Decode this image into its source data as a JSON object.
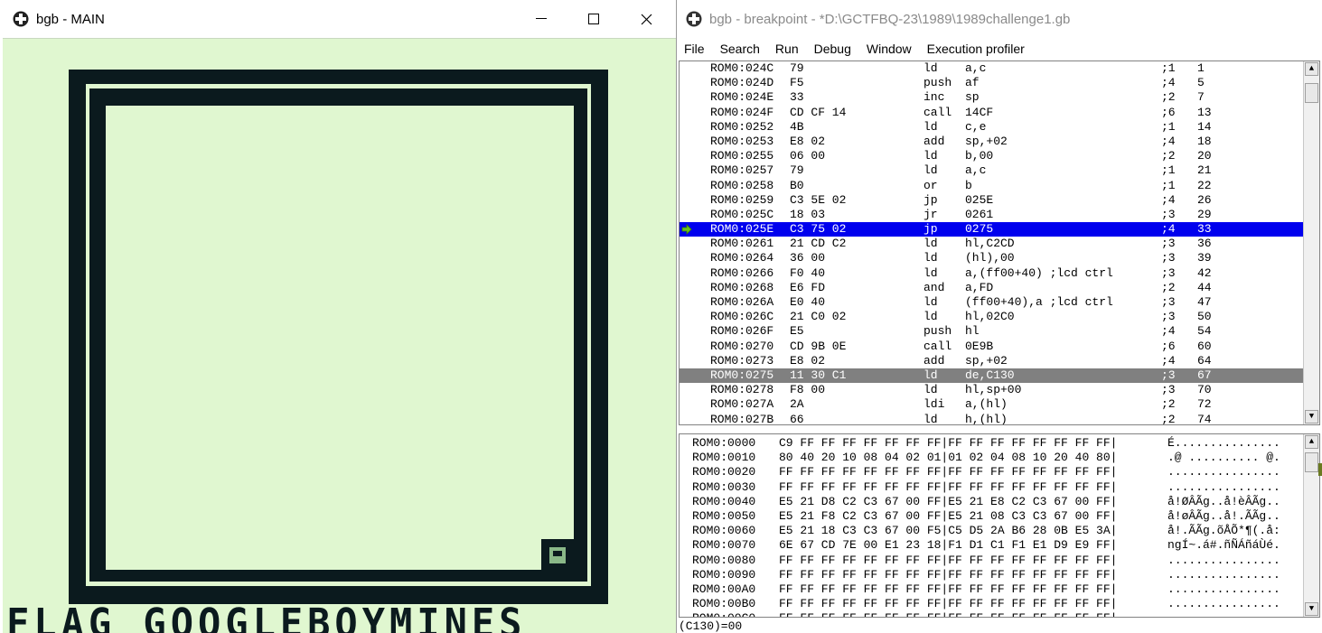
{
  "main_window": {
    "title": "bgb - MAIN",
    "controls": {
      "minimize": "—",
      "maximize": "☐",
      "close": "✕"
    },
    "game_text": "FLAG GOOGLEBOYMINES",
    "colors": {
      "screen_bg": "#e0f7d0",
      "dark": "#0b1a1e"
    }
  },
  "debugger_window": {
    "title": "bgb - breakpoint - *D:\\GCTFBQ-23\\1989\\1989challenge1.gb",
    "menu": [
      "File",
      "Search",
      "Run",
      "Debug",
      "Window",
      "Execution profiler"
    ],
    "disasm": [
      {
        "addr": "ROM0:024C",
        "bytes": "79",
        "mn": "ld",
        "op": "a,c",
        "cyc": ";1",
        "tot": "1"
      },
      {
        "addr": "ROM0:024D",
        "bytes": "F5",
        "mn": "push",
        "op": "af",
        "cyc": ";4",
        "tot": "5"
      },
      {
        "addr": "ROM0:024E",
        "bytes": "33",
        "mn": "inc",
        "op": "sp",
        "cyc": ";2",
        "tot": "7"
      },
      {
        "addr": "ROM0:024F",
        "bytes": "CD CF 14",
        "mn": "call",
        "op": "14CF",
        "cyc": ";6",
        "tot": "13"
      },
      {
        "addr": "ROM0:0252",
        "bytes": "4B",
        "mn": "ld",
        "op": "c,e",
        "cyc": ";1",
        "tot": "14"
      },
      {
        "addr": "ROM0:0253",
        "bytes": "E8 02",
        "mn": "add",
        "op": "sp,+02",
        "cyc": ";4",
        "tot": "18"
      },
      {
        "addr": "ROM0:0255",
        "bytes": "06 00",
        "mn": "ld",
        "op": "b,00",
        "cyc": ";2",
        "tot": "20"
      },
      {
        "addr": "ROM0:0257",
        "bytes": "79",
        "mn": "ld",
        "op": "a,c",
        "cyc": ";1",
        "tot": "21"
      },
      {
        "addr": "ROM0:0258",
        "bytes": "B0",
        "mn": "or",
        "op": "b",
        "cyc": ";1",
        "tot": "22"
      },
      {
        "addr": "ROM0:0259",
        "bytes": "C3 5E 02",
        "mn": "jp",
        "op": "025E",
        "cyc": ";4",
        "tot": "26"
      },
      {
        "addr": "ROM0:025C",
        "bytes": "18 03",
        "mn": "jr",
        "op": "0261",
        "cyc": ";3",
        "tot": "29"
      },
      {
        "addr": "ROM0:025E",
        "bytes": "C3 75 02",
        "mn": "jp",
        "op": "0275",
        "cyc": ";4",
        "tot": "33"
      },
      {
        "addr": "ROM0:0261",
        "bytes": "21 CD C2",
        "mn": "ld",
        "op": "hl,C2CD",
        "cyc": ";3",
        "tot": "36"
      },
      {
        "addr": "ROM0:0264",
        "bytes": "36 00",
        "mn": "ld",
        "op": "(hl),00",
        "cyc": ";3",
        "tot": "39"
      },
      {
        "addr": "ROM0:0266",
        "bytes": "F0 40",
        "mn": "ld",
        "op": "a,(ff00+40) ;lcd ctrl",
        "cyc": ";3",
        "tot": "42"
      },
      {
        "addr": "ROM0:0268",
        "bytes": "E6 FD",
        "mn": "and",
        "op": "a,FD",
        "cyc": ";2",
        "tot": "44"
      },
      {
        "addr": "ROM0:026A",
        "bytes": "E0 40",
        "mn": "ld",
        "op": "(ff00+40),a ;lcd ctrl",
        "cyc": ";3",
        "tot": "47"
      },
      {
        "addr": "ROM0:026C",
        "bytes": "21 C0 02",
        "mn": "ld",
        "op": "hl,02C0",
        "cyc": ";3",
        "tot": "50"
      },
      {
        "addr": "ROM0:026F",
        "bytes": "E5",
        "mn": "push",
        "op": "hl",
        "cyc": ";4",
        "tot": "54"
      },
      {
        "addr": "ROM0:0270",
        "bytes": "CD 9B 0E",
        "mn": "call",
        "op": "0E9B",
        "cyc": ";6",
        "tot": "60"
      },
      {
        "addr": "ROM0:0273",
        "bytes": "E8 02",
        "mn": "add",
        "op": "sp,+02",
        "cyc": ";4",
        "tot": "64"
      },
      {
        "addr": "ROM0:0275",
        "bytes": "11 30 C1",
        "mn": "ld",
        "op": "de,C130",
        "cyc": ";3",
        "tot": "67"
      },
      {
        "addr": "ROM0:0278",
        "bytes": "F8 00",
        "mn": "ld",
        "op": "hl,sp+00",
        "cyc": ";3",
        "tot": "70"
      },
      {
        "addr": "ROM0:027A",
        "bytes": "2A",
        "mn": "ldi",
        "op": "a,(hl)",
        "cyc": ";2",
        "tot": "72"
      },
      {
        "addr": "ROM0:027B",
        "bytes": "66",
        "mn": "ld",
        "op": "h,(hl)",
        "cyc": ";2",
        "tot": "74"
      }
    ],
    "current_row": 11,
    "cursor_row": 21,
    "hexdump": [
      {
        "addr": "ROM0:0000",
        "bytes": "C9 FF FF FF FF FF FF FF|FF FF FF FF FF FF FF FF|",
        "ascii": "É..............."
      },
      {
        "addr": "ROM0:0010",
        "bytes": "80 40 20 10 08 04 02 01|01 02 04 08 10 20 40 80|",
        "ascii": ".@ .......... @."
      },
      {
        "addr": "ROM0:0020",
        "bytes": "FF FF FF FF FF FF FF FF|FF FF FF FF FF FF FF FF|",
        "ascii": "................"
      },
      {
        "addr": "ROM0:0030",
        "bytes": "FF FF FF FF FF FF FF FF|FF FF FF FF FF FF FF FF|",
        "ascii": "................"
      },
      {
        "addr": "ROM0:0040",
        "bytes": "E5 21 D8 C2 C3 67 00 FF|E5 21 E8 C2 C3 67 00 FF|",
        "ascii": "å!ØÂÃg..å!èÂÃg.."
      },
      {
        "addr": "ROM0:0050",
        "bytes": "E5 21 F8 C2 C3 67 00 FF|E5 21 08 C3 C3 67 00 FF|",
        "ascii": "å!øÂÃg..å!.ÃÃg.."
      },
      {
        "addr": "ROM0:0060",
        "bytes": "E5 21 18 C3 C3 67 00 F5|C5 D5 2A B6 28 0B E5 3A|",
        "ascii": "å!.ÃÃg.õÅÕ*¶(.å:"
      },
      {
        "addr": "ROM0:0070",
        "bytes": "6E 67 CD 7E 00 E1 23 18|F1 D1 C1 F1 E1 D9 E9 FF|",
        "ascii": "ngÍ~.á#.ñÑÁñáÙé."
      },
      {
        "addr": "ROM0:0080",
        "bytes": "FF FF FF FF FF FF FF FF|FF FF FF FF FF FF FF FF|",
        "ascii": "................"
      },
      {
        "addr": "ROM0:0090",
        "bytes": "FF FF FF FF FF FF FF FF|FF FF FF FF FF FF FF FF|",
        "ascii": "................"
      },
      {
        "addr": "ROM0:00A0",
        "bytes": "FF FF FF FF FF FF FF FF|FF FF FF FF FF FF FF FF|",
        "ascii": "................"
      },
      {
        "addr": "ROM0:00B0",
        "bytes": "FF FF FF FF FF FF FF FF|FF FF FF FF FF FF FF FF|",
        "ascii": "................"
      },
      {
        "addr": "ROM0:00C0",
        "bytes": "FF FF FF FF FF FF FF FF|FF FF FF FF FF FF FF FF|",
        "ascii": "................"
      }
    ],
    "status": "(C130)=00",
    "colors": {
      "current_line": "#0000ee",
      "cursor_line": "#808080",
      "arrow": "#6ac41a"
    }
  }
}
